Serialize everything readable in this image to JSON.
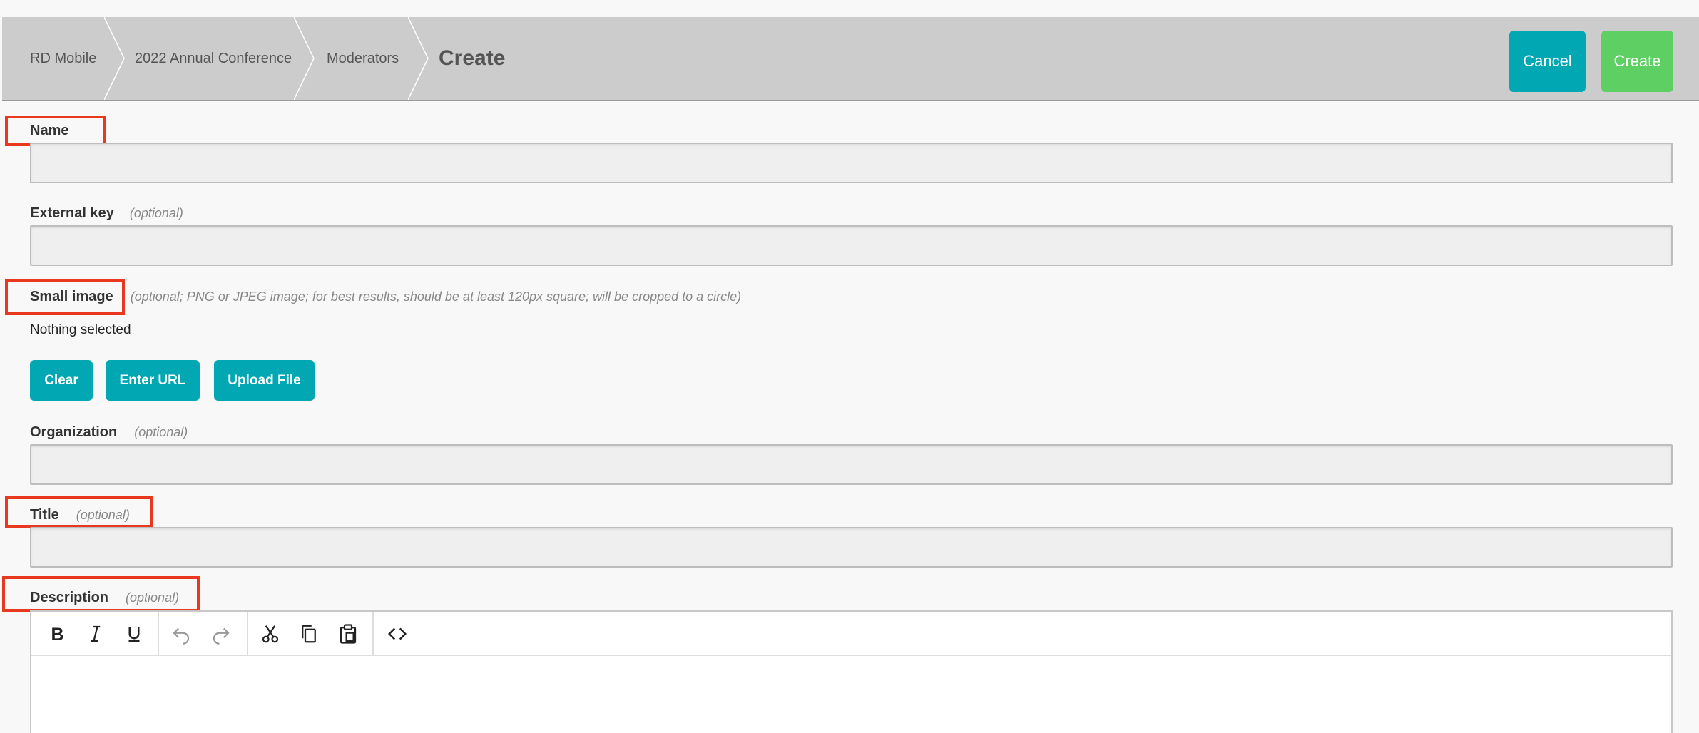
{
  "breadcrumb": {
    "items": [
      "RD Mobile",
      "2022 Annual Conference",
      "Moderators"
    ],
    "current": "Create"
  },
  "header_buttons": {
    "cancel": "Cancel",
    "create": "Create"
  },
  "colors": {
    "accent": "#02a7b4",
    "success": "#5ecf63",
    "annotation": "#e8391e",
    "header_bg": "#cccccc"
  },
  "form": {
    "name": {
      "label": "Name",
      "value": ""
    },
    "external_key": {
      "label": "External key",
      "optional": "(optional)",
      "value": ""
    },
    "small_image": {
      "label": "Small image",
      "hint": "(optional; PNG or JPEG image; for best results, should be at least 120px square; will be cropped to a circle)",
      "status": "Nothing selected",
      "buttons": {
        "clear": "Clear",
        "enter_url": "Enter URL",
        "upload": "Upload File"
      }
    },
    "organization": {
      "label": "Organization",
      "optional": "(optional)",
      "value": ""
    },
    "title": {
      "label": "Title",
      "optional": "(optional)",
      "value": ""
    },
    "description": {
      "label": "Description",
      "optional": "(optional)",
      "toolbar": [
        "bold-icon",
        "italic-icon",
        "underline-icon",
        "undo-icon",
        "redo-icon",
        "cut-icon",
        "copy-icon",
        "paste-icon",
        "source-code-icon"
      ]
    }
  }
}
